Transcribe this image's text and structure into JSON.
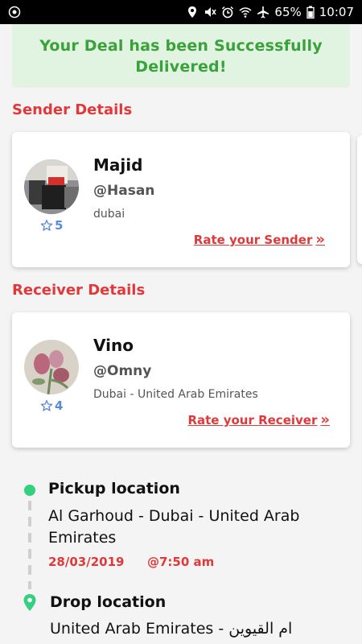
{
  "status_bar": {
    "battery": "65%",
    "time": "10:07",
    "icons": [
      "app-notification-icon",
      "location-icon",
      "mute-icon",
      "alarm-icon",
      "wifi-icon",
      "airplane-icon",
      "battery-icon"
    ]
  },
  "banner": {
    "line1": "Your Deal has been Successfully",
    "line2": "Delivered!"
  },
  "sender": {
    "section_title": "Sender Details",
    "name": "Majid",
    "handle": "@Hasan",
    "location": "dubai",
    "rating": "5",
    "rate_link": "Rate your Sender"
  },
  "receiver": {
    "section_title": "Receiver Details",
    "name": "Vino",
    "handle": "@Omny",
    "location": "Dubai - United Arab Emirates",
    "rating": "4",
    "rate_link": "Rate your Receiver"
  },
  "pickup": {
    "title": "Pickup location",
    "address": "Al Garhoud - Dubai - United Arab Emirates",
    "date": "28/03/2019",
    "time": "@7:50 am"
  },
  "drop": {
    "title": "Drop location",
    "address": "United Arab Emirates - ام القيوين"
  },
  "colors": {
    "accent_red": "#e0393b",
    "success_green": "#3aa23a",
    "success_bg": "#e1f3e1",
    "rating_blue": "#5b8bd6",
    "location_green": "#35d07f"
  }
}
